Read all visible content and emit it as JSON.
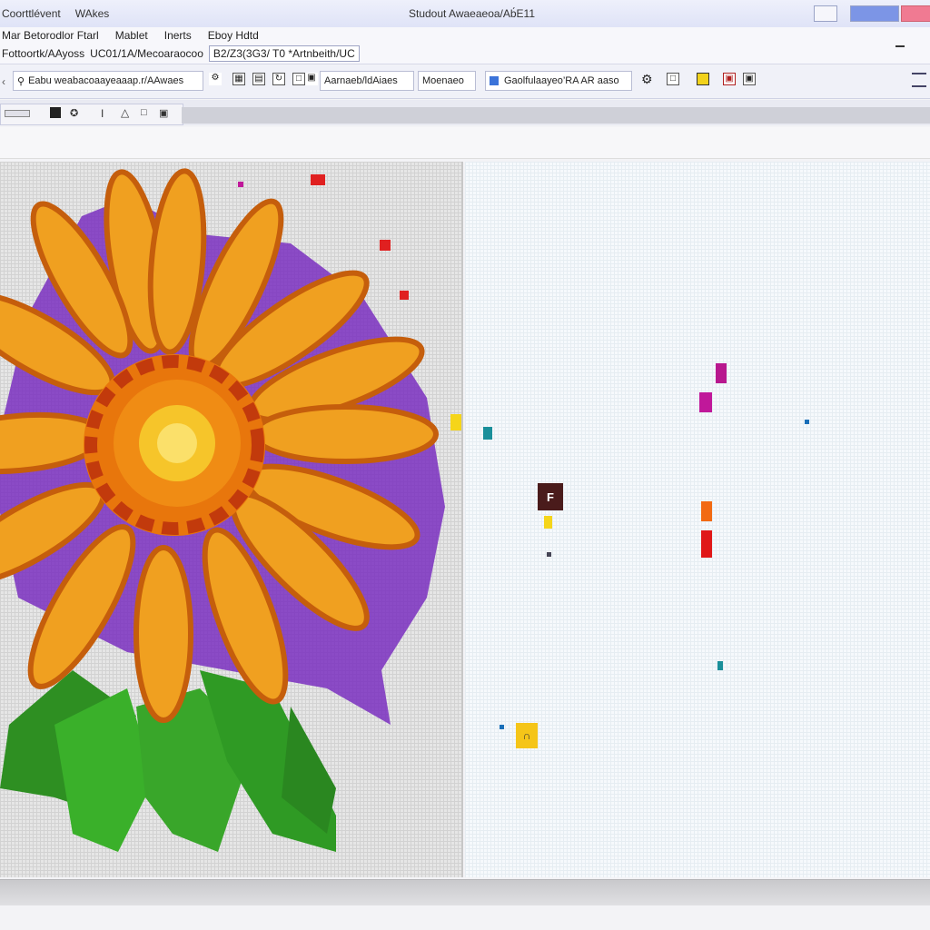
{
  "window": {
    "menu_left": [
      "Coorttlévent",
      "WAkes"
    ],
    "title": "Studout Awaeaeoa/Ab́E11"
  },
  "menubar": {
    "items": [
      "Mar Betorodlor Ftarl",
      "Mablet",
      "Inerts",
      "Eboy Hdtd"
    ],
    "path_label": "Fottoortk/AAyoss",
    "path_box1": "UC01/1A/Mecoaraocoo",
    "path_box2": "B2/Z3(3G3/ T0 *Artnbeith/UC"
  },
  "toolbar": {
    "search_text": "Eabu weabacoaayeaaap.r/AAwaes",
    "item_a": "Aarnaeb/ldAiaes",
    "item_b": "Moenaeo",
    "item_c": "Gaolfulaayeo’RA  AR aaso"
  },
  "status": {
    "badge": "F"
  },
  "icons": [
    "search-icon",
    "grid-icon",
    "layers-icon",
    "rotate-icon",
    "file-icon",
    "highlight-icon",
    "image-icon",
    "frame-icon"
  ],
  "colors": {
    "petal": "#f0a020",
    "petal_dark": "#d56a10",
    "center": "#e8760c",
    "center_core": "#f6c52a",
    "leaf": "#39a62a",
    "purple": "#7a2fbf",
    "accent_red": "#e02020",
    "accent_magenta": "#c0189a"
  }
}
